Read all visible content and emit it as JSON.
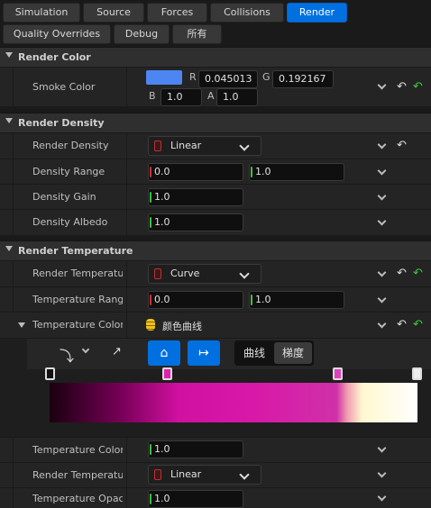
{
  "tabs_row1": [
    {
      "label": "Simulation",
      "active": false
    },
    {
      "label": "Source",
      "active": false
    },
    {
      "label": "Forces",
      "active": false
    },
    {
      "label": "Collisions",
      "active": false
    },
    {
      "label": "Render",
      "active": true
    }
  ],
  "tabs_row2": [
    {
      "label": "Quality Overrides",
      "active": false
    },
    {
      "label": "Debug",
      "active": false
    },
    {
      "label": "所有",
      "active": false
    }
  ],
  "render_color": {
    "header": "Render Color",
    "smoke_color": {
      "label": "Smoke Color",
      "swatch": "#4d86f2",
      "r_label": "R",
      "r": "0.045013",
      "g_label": "G",
      "g": "0.192167",
      "b_label": "B",
      "b": "1.0",
      "a_label": "A",
      "a": "1.0"
    }
  },
  "render_density": {
    "header": "Render Density",
    "render_density": {
      "label": "Render Density",
      "value": "Linear"
    },
    "density_range": {
      "label": "Density Range",
      "min": "0.0",
      "max": "1.0"
    },
    "density_gain": {
      "label": "Density Gain",
      "value": "1.0"
    },
    "density_albedo": {
      "label": "Density Albedo",
      "value": "1.0"
    }
  },
  "render_temperature": {
    "header": "Render Temperature",
    "render_temperature": {
      "label": "Render Temperature",
      "value": "Curve"
    },
    "temperature_range": {
      "label": "Temperature Range",
      "min": "0.0",
      "max": "1.0"
    },
    "temperature_color_curve": {
      "label": "Temperature Color Curve",
      "asset": "颜色曲线"
    },
    "curve_editor": {
      "seg_curve": "曲线",
      "seg_gradient": "梯度",
      "active_segment": "梯度"
    },
    "temperature_color_gain": {
      "label": "Temperature Color Gain",
      "value": "1.0"
    },
    "render_temperature_opacity": {
      "label": "Render Temperature Opacity",
      "value": "Linear"
    },
    "temperature_opacity": {
      "label": "Temperature Opacity",
      "value": "1.0"
    }
  },
  "colors": {
    "accent": "#0070e0",
    "red_channel": "#d03030",
    "green_channel": "#40c040",
    "reset_green": "#3ec93e"
  }
}
